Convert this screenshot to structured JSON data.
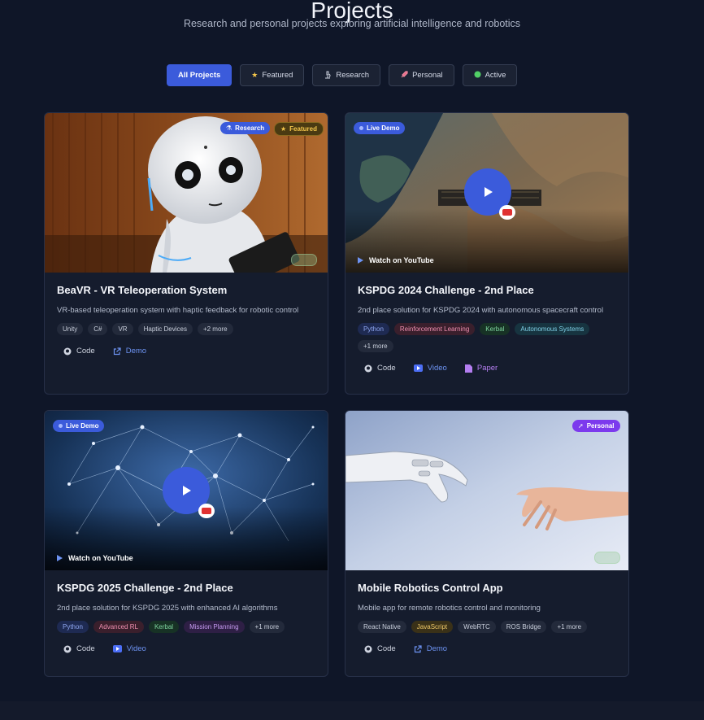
{
  "header": {
    "title": "Projects",
    "subtitle": "Research and personal projects exploring artificial intelligence and robotics"
  },
  "filters": [
    {
      "label": "All Projects",
      "icon": ""
    },
    {
      "label": "Featured",
      "icon": "star-icon"
    },
    {
      "label": "Research",
      "icon": "microscope-icon"
    },
    {
      "label": "Personal",
      "icon": "rocket-icon"
    },
    {
      "label": "Active",
      "icon": "green-circle-icon"
    }
  ],
  "projects": [
    {
      "title": "BeaVR - VR Teleoperation System",
      "description": "VR-based teleoperation system with haptic feedback for robotic control",
      "badges": [
        "Research",
        "Featured"
      ],
      "tags": [
        "Unity",
        "C#",
        "VR",
        "Haptic Devices",
        "+2 more"
      ],
      "links": {
        "code": "Code",
        "demo": "Demo"
      }
    },
    {
      "title": "KSPDG 2024 Challenge - 2nd Place",
      "description": "2nd place solution for KSPDG 2024 with autonomous spacecraft control",
      "badges": [
        "Live Demo"
      ],
      "watch": "Watch on YouTube",
      "tags": [
        "Python",
        "Reinforcement Learning",
        "Kerbal",
        "Autonomous Systems",
        "+1 more"
      ],
      "links": {
        "code": "Code",
        "video": "Video",
        "paper": "Paper"
      }
    },
    {
      "title": "KSPDG 2025 Challenge - 2nd Place",
      "description": "2nd place solution for KSPDG 2025 with enhanced AI algorithms",
      "badges": [
        "Live Demo"
      ],
      "watch": "Watch on YouTube",
      "tags": [
        "Python",
        "Advanced RL",
        "Kerbal",
        "Mission Planning",
        "+1 more"
      ],
      "links": {
        "code": "Code",
        "video": "Video"
      }
    },
    {
      "title": "Mobile Robotics Control App",
      "description": "Mobile app for remote robotics control and monitoring",
      "badges": [
        "Personal"
      ],
      "tags": [
        "React Native",
        "JavaScript",
        "WebRTC",
        "ROS Bridge",
        "+1 more"
      ],
      "links": {
        "code": "Code",
        "demo": "Demo"
      }
    }
  ],
  "colors": {
    "accent": "#3b5bdb",
    "background": "#0f1628",
    "card": "#151c2d"
  }
}
